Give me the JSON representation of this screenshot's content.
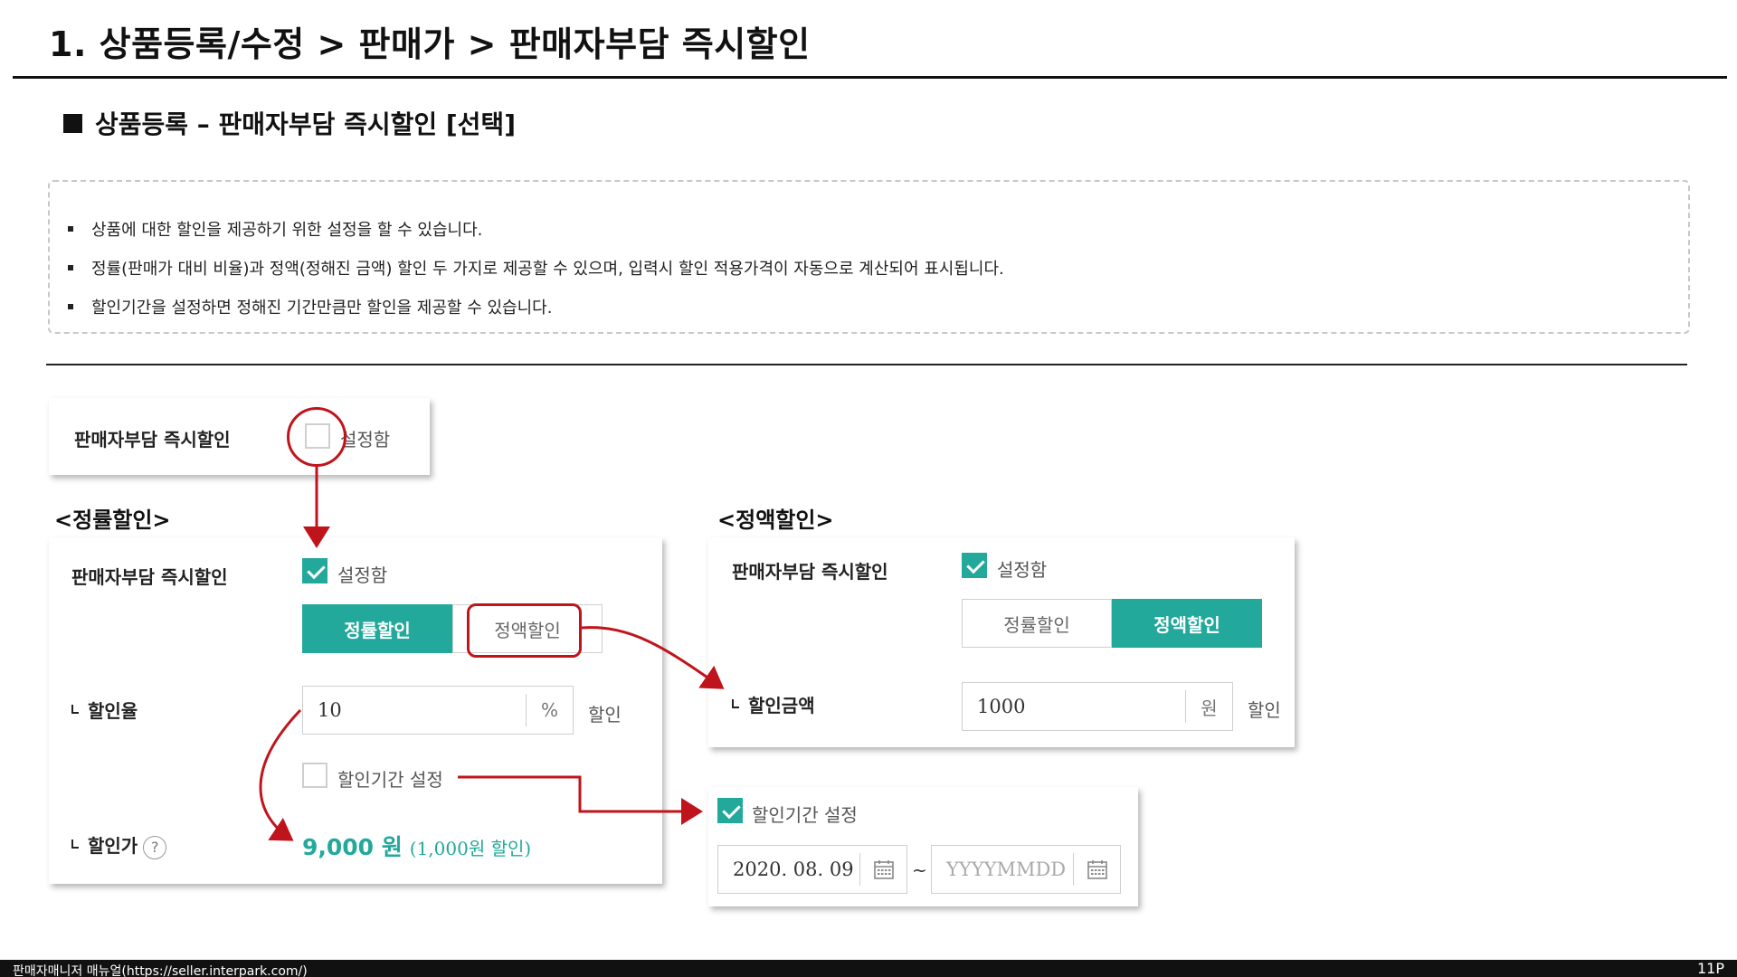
{
  "page_title": "1. 상품등록/수정 > 판매가 > 판매자부담 즉시할인",
  "section_heading": "상품등록 – 판매자부담 즉시할인 [선택]",
  "info_items": [
    "상품에 대한 할인을 제공하기 위한 설정을 할 수 있습니다.",
    "정률(판매가 대비 비율)과 정액(정해진 금액) 할인 두 가지로 제공할 수 있으며, 입력시 할인 적용가격이 자동으로 계산되어 표시됩니다.",
    "할인기간을 설정하면 정해진 기간만큼만 할인을 제공할 수 있습니다."
  ],
  "top_panel": {
    "label": "판매자부담 즉시할인",
    "checkbox_label": "설정함",
    "checked": false
  },
  "rate_panel": {
    "caption": "<정률할인>",
    "label": "판매자부담 즉시할인",
    "checkbox_label": "설정함",
    "checked": true,
    "tabs": [
      "정률할인",
      "정액할인"
    ],
    "active_tab": "정률할인",
    "rate_label": "할인율",
    "rate_value": "10",
    "rate_unit": "%",
    "rate_suffix": "할인",
    "period_label": "할인기간 설정",
    "period_checked": false,
    "price_label": "할인가",
    "help_glyph": "?",
    "price_value": "9,000 원",
    "price_note": "(1,000원 할인)"
  },
  "amount_panel": {
    "caption": "<정액할인>",
    "label": "판매자부담 즉시할인",
    "checkbox_label": "설정함",
    "checked": true,
    "tabs": [
      "정률할인",
      "정액할인"
    ],
    "active_tab": "정액할인",
    "amount_label": "할인금액",
    "amount_value": "1000",
    "amount_unit": "원",
    "amount_suffix": "할인"
  },
  "period_panel": {
    "label": "할인기간 설정",
    "checked": true,
    "start_date": "2020. 08. 09",
    "separator": "~",
    "end_placeholder": "YYYYMMDD"
  },
  "footer": {
    "text": "판매자매니저 매뉴얼(https://seller.interpark.com/)",
    "page": "11P"
  },
  "colors": {
    "accent": "#22a99b",
    "highlight": "#c0141c"
  }
}
